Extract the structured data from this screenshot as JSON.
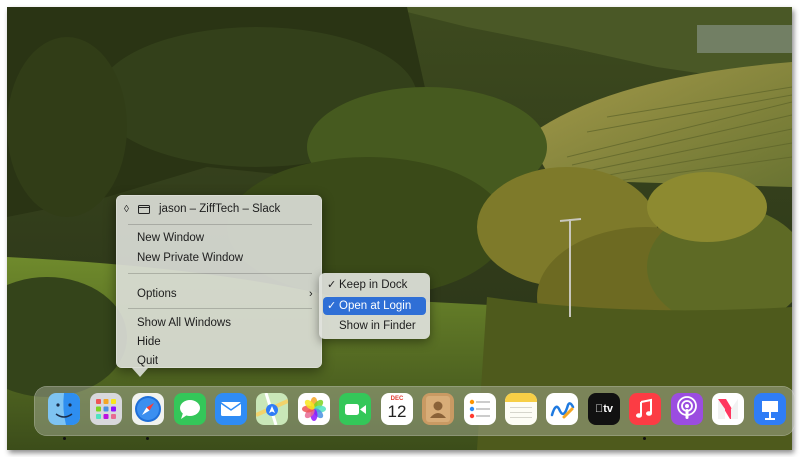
{
  "context_menu": {
    "title": "jason – ZiffTech – Slack",
    "items": {
      "new_window": "New Window",
      "new_private_window": "New Private Window",
      "options": "Options",
      "show_all_windows": "Show All Windows",
      "hide": "Hide",
      "quit": "Quit"
    }
  },
  "options_submenu": {
    "keep_in_dock": "Keep in Dock",
    "open_at_login": "Open at Login",
    "show_in_finder": "Show in Finder",
    "check_glyph": "✓"
  },
  "dock": {
    "calendar_month": "DEC",
    "calendar_day": "12",
    "tv_label": "tv",
    "apps": [
      "finder",
      "launchpad",
      "safari",
      "messages",
      "mail",
      "maps",
      "photos",
      "facetime",
      "calendar",
      "contacts",
      "reminders",
      "notes",
      "freeform",
      "tv",
      "music",
      "podcasts",
      "news",
      "keynote"
    ]
  },
  "colors": {
    "menu_highlight": "#2f6fd6",
    "menu_background": "#dee0da"
  }
}
